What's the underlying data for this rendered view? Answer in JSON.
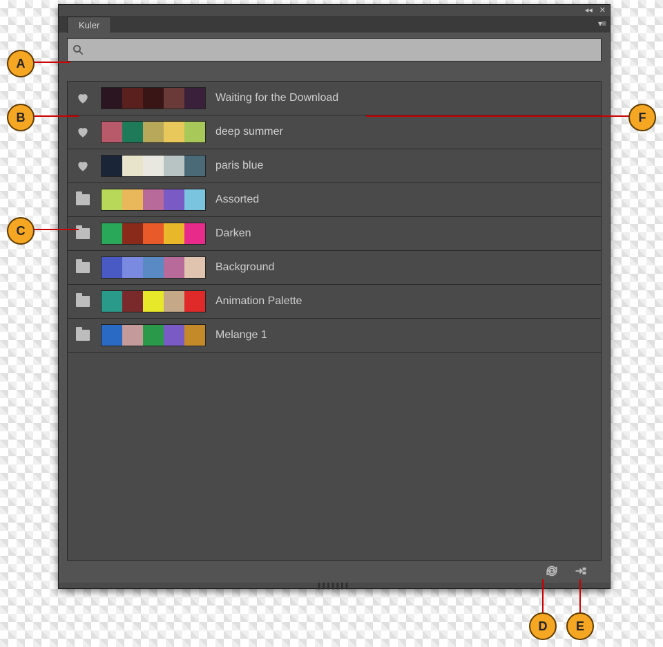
{
  "panel": {
    "tab": "Kuler"
  },
  "search": {
    "value": ""
  },
  "themes": [
    {
      "icon": "heart",
      "name": "Waiting for the Download",
      "colors": [
        "#2b1520",
        "#5a201e",
        "#3a1515",
        "#6a3a38",
        "#3a203a"
      ]
    },
    {
      "icon": "heart",
      "name": "deep summer",
      "colors": [
        "#b85a6a",
        "#1f7a5a",
        "#b8a85a",
        "#e8c85a",
        "#a8c85a"
      ]
    },
    {
      "icon": "heart",
      "name": "paris blue",
      "colors": [
        "#1a2538",
        "#e8e4cb",
        "#e8e8e1",
        "#b8c4c4",
        "#4a6a78"
      ]
    },
    {
      "icon": "folder",
      "name": "Assorted",
      "colors": [
        "#b8d85a",
        "#e8b85a",
        "#b86a9a",
        "#7a5ac4",
        "#7ac4e0"
      ]
    },
    {
      "icon": "folder",
      "name": "Darken",
      "colors": [
        "#2aa85a",
        "#8a2a1a",
        "#e85a2a",
        "#e8b82a",
        "#e82a8a"
      ]
    },
    {
      "icon": "folder",
      "name": "Background",
      "colors": [
        "#4a5ac4",
        "#7a8ae0",
        "#5a8ac4",
        "#b86a9a",
        "#e0c4b0"
      ]
    },
    {
      "icon": "folder",
      "name": "Animation Palette",
      "colors": [
        "#2a9a8a",
        "#7a2a2a",
        "#e8e82a",
        "#c4a888",
        "#e02a2a"
      ]
    },
    {
      "icon": "folder",
      "name": "Melange 1",
      "colors": [
        "#2a6ac4",
        "#c49a9a",
        "#2a9a4a",
        "#7a5ac4",
        "#c48a2a"
      ]
    }
  ],
  "callouts": {
    "A": "A",
    "B": "B",
    "C": "C",
    "D": "D",
    "E": "E",
    "F": "F"
  }
}
